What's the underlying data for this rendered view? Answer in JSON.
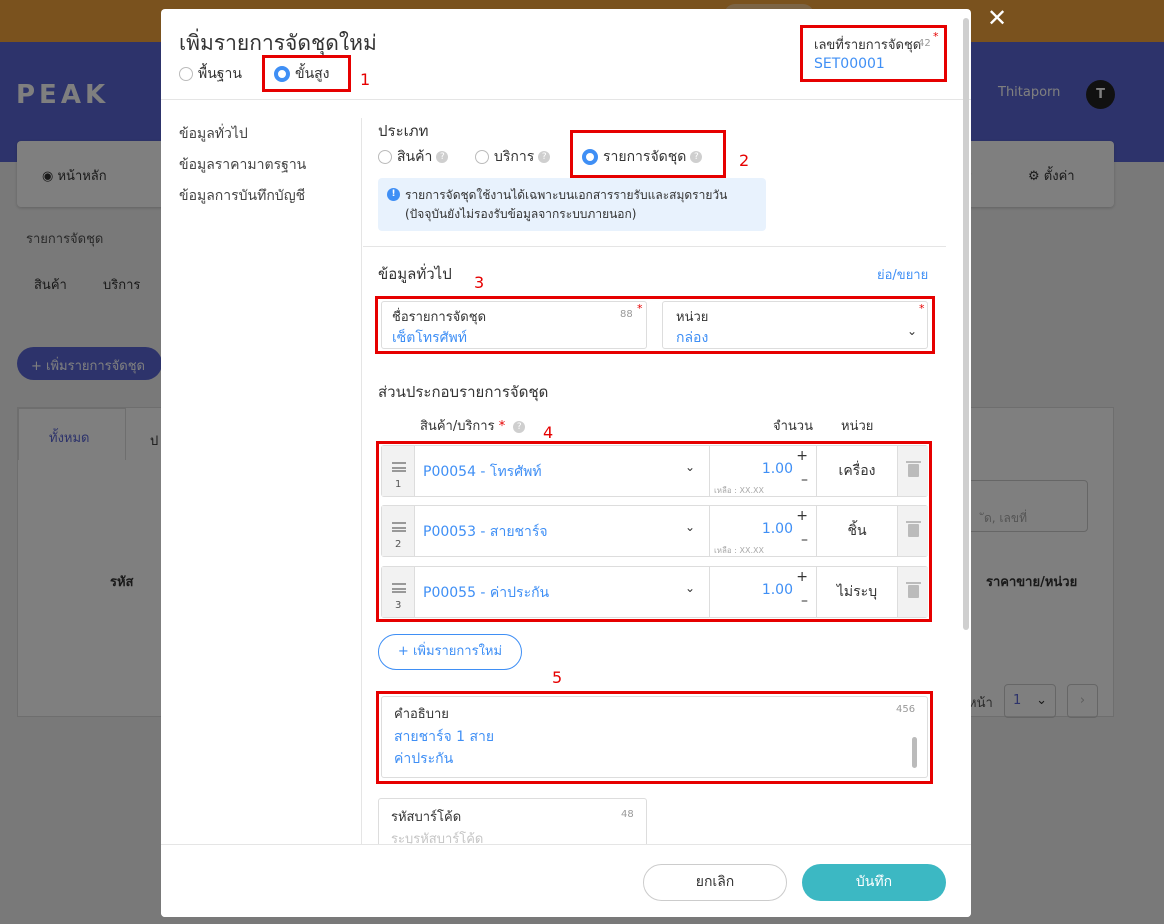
{
  "background": {
    "logo": "PEAK",
    "user_name": "Thitaporn",
    "avatar_letter": "T",
    "nav_home": "หน้าหลัก",
    "nav_settings": "ตั้งค่า",
    "nav_partial": "s",
    "breadcrumb": "รายการจัดชุด",
    "subtabs": [
      "สินค้า",
      "บริการ"
    ],
    "add_button": "+ เพิ่มรายการจัดชุด",
    "tab_all": "ทั้งหมด",
    "tab_partial": "ป",
    "col_code": "รหัส",
    "col_price": "ราคาขาย/หน่วย",
    "search_placeholder": "ัด, เลขที่",
    "pager_label": "หน้า",
    "pager_value": "1"
  },
  "modal": {
    "title": "เพิ่มรายการจัดชุดใหม่",
    "mode_options": [
      "พื้นฐาน",
      "ขั้นสูง"
    ],
    "mode_selected": "ขั้นสูง",
    "doc_number_label": "เลขที่รายการจัดชุด",
    "doc_number_count": "42",
    "doc_number_value": "SET00001",
    "side_nav": [
      "ข้อมูลทั่วไป",
      "ข้อมูลราคามาตรฐาน",
      "ข้อมูลการบันทึกบัญชี"
    ],
    "type_label": "ประเภท",
    "type_options": [
      "สินค้า",
      "บริการ",
      "รายการจัดชุด"
    ],
    "type_selected": "รายการจัดชุด",
    "info_line1": "รายการจัดชุดใช้งานได้เฉพาะบนเอกสารรายรับและสมุดรายวัน",
    "info_line2": "(ปัจจุบันยังไม่รองรับข้อมูลจากระบบภายนอก)",
    "general_heading": "ข้อมูลทั่วไป",
    "collapse_link": "ย่อ/ขยาย",
    "name_label": "ชื่อรายการจัดชุด",
    "name_count": "88",
    "name_value": "เซ็ตโทรศัพท์",
    "unit_label": "หน่วย",
    "unit_value": "กล่อง",
    "components_heading": "ส่วนประกอบรายการจัดชุด",
    "col_product": "สินค้า/บริการ",
    "col_qty": "จำนวน",
    "col_unit": "หน่วย",
    "items": [
      {
        "index": "1",
        "product": "P00054 - โทรศัพท์",
        "qty": "1.00",
        "remaining": "เหลือ : XX.XX",
        "unit": "เครื่อง"
      },
      {
        "index": "2",
        "product": "P00053 - สายชาร์จ",
        "qty": "1.00",
        "remaining": "เหลือ : XX.XX",
        "unit": "ชิ้น"
      },
      {
        "index": "3",
        "product": "P00055 - ค่าประกัน",
        "qty": "1.00",
        "remaining": "",
        "unit": "ไม่ระบุ"
      }
    ],
    "add_item_button": "+ เพิ่มรายการใหม่",
    "desc_label": "คำอธิบาย",
    "desc_count": "456",
    "desc_line1": "สายชาร์จ 1 สาย",
    "desc_line2": "ค่าประกัน",
    "barcode_label": "รหัสบาร์โค้ด",
    "barcode_count": "48",
    "barcode_placeholder": "ระบุรหัสบาร์โค้ด",
    "cancel_button": "ยกเลิก",
    "save_button": "บันทึก"
  },
  "annotations": [
    "1",
    "2",
    "3",
    "4",
    "5"
  ],
  "colors": {
    "accent": "#3f8ff5",
    "brand": "#5b67d6",
    "save": "#3cb8c3",
    "annotation": "#e60000"
  }
}
